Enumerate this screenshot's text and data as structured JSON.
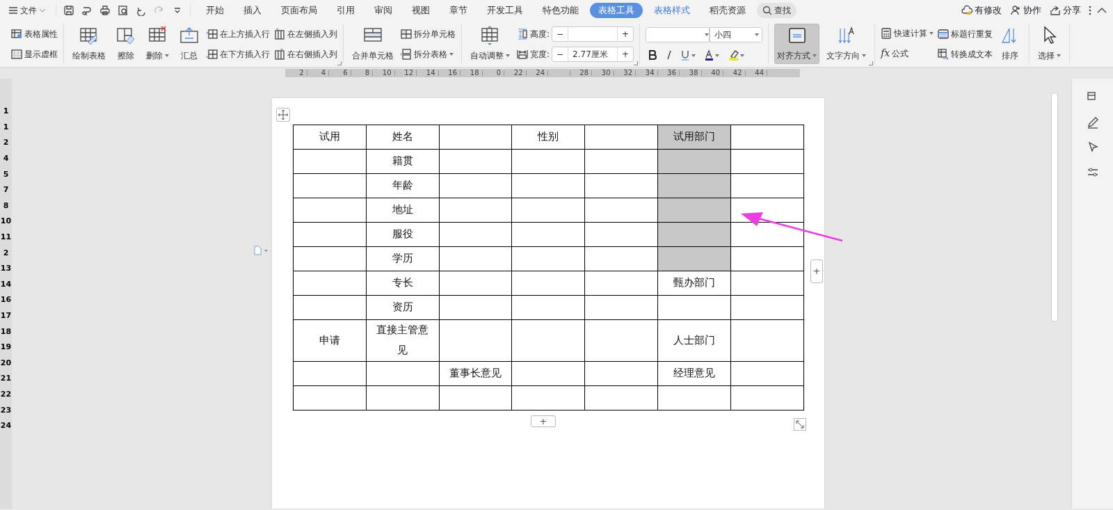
{
  "title_bar": {
    "file_menu": "文件",
    "tabs": [
      {
        "label": "开始",
        "selected": false,
        "contextual": false
      },
      {
        "label": "插入",
        "selected": false,
        "contextual": false
      },
      {
        "label": "页面布局",
        "selected": false,
        "contextual": false
      },
      {
        "label": "引用",
        "selected": false,
        "contextual": false
      },
      {
        "label": "审阅",
        "selected": false,
        "contextual": false
      },
      {
        "label": "视图",
        "selected": false,
        "contextual": false
      },
      {
        "label": "章节",
        "selected": false,
        "contextual": false
      },
      {
        "label": "开发工具",
        "selected": false,
        "contextual": false
      },
      {
        "label": "特色功能",
        "selected": false,
        "contextual": false
      },
      {
        "label": "表格工具",
        "selected": true,
        "contextual": true
      },
      {
        "label": "表格样式",
        "selected": false,
        "contextual": true
      },
      {
        "label": "稻壳资源",
        "selected": false,
        "contextual": false
      }
    ],
    "search": "查找",
    "actions": [
      "有修改",
      "协作",
      "分享"
    ]
  },
  "ribbon": [
    {
      "launcher": false,
      "columns": [
        {
          "kind": "stack",
          "items": [
            {
              "label": "表格属性",
              "dropdown": false
            },
            {
              "label": "显示虚框",
              "dropdown": false
            }
          ]
        }
      ]
    },
    {
      "launcher": true,
      "columns": [
        {
          "kind": "large",
          "label": "绘制表格",
          "dropdown": false,
          "selected": false
        },
        {
          "kind": "large",
          "label": "擦除",
          "dropdown": false,
          "selected": false
        },
        {
          "kind": "large",
          "label": "删除",
          "dropdown": true,
          "selected": false
        },
        {
          "kind": "large",
          "label": "汇总",
          "dropdown": false,
          "selected": false
        },
        {
          "kind": "stack",
          "items": [
            {
              "label": "在上方插入行",
              "dropdown": false
            },
            {
              "label": "在下方插入行",
              "dropdown": false
            }
          ]
        },
        {
          "kind": "stack",
          "items": [
            {
              "label": "在左侧插入列",
              "dropdown": false
            },
            {
              "label": "在右侧插入列",
              "dropdown": false
            }
          ]
        }
      ]
    },
    {
      "launcher": false,
      "columns": [
        {
          "kind": "large",
          "label": "合并单元格",
          "dropdown": false,
          "selected": false
        },
        {
          "kind": "stack",
          "items": [
            {
              "label": "拆分单元格",
              "dropdown": false
            },
            {
              "label": "拆分表格",
              "dropdown": true
            }
          ]
        }
      ]
    },
    {
      "launcher": true,
      "columns": [
        {
          "kind": "large",
          "label": "自动调整",
          "dropdown": true,
          "selected": false
        },
        {
          "kind": "spinners",
          "items": [
            {
              "label": "高度:",
              "decrement": "−",
              "increment": "+"
            },
            {
              "label": "宽度:",
              "value": "2.77厘米",
              "decrement": "−",
              "increment": "+"
            }
          ]
        }
      ]
    },
    {
      "launcher": false,
      "columns": [
        {
          "kind": "font",
          "size": "小四"
        }
      ]
    },
    {
      "launcher": true,
      "columns": [
        {
          "kind": "large",
          "label": "对齐方式",
          "dropdown": true,
          "selected": true
        },
        {
          "kind": "large",
          "label": "文字方向",
          "dropdown": true,
          "selected": false
        }
      ]
    },
    {
      "launcher": false,
      "columns": [
        {
          "kind": "stack",
          "items": [
            {
              "label": "快速计算",
              "dropdown": true
            },
            {
              "label": "公式",
              "dropdown": false,
              "glyph": "fx"
            }
          ]
        },
        {
          "kind": "stack",
          "items": [
            {
              "label": "标题行重复",
              "dropdown": false
            },
            {
              "label": "转换成文本",
              "dropdown": false
            }
          ]
        },
        {
          "kind": "large",
          "label": "排序",
          "dropdown": false,
          "selected": false
        }
      ]
    },
    {
      "launcher": false,
      "columns": [
        {
          "kind": "large",
          "label": "选择",
          "dropdown": true,
          "selected": false
        }
      ]
    }
  ],
  "ruler": [
    "2",
    "4",
    "6",
    "8",
    "10",
    "12",
    "14",
    "16",
    "18",
    "0",
    "22",
    "24",
    "28",
    "30",
    "32",
    "34",
    "36",
    "38",
    "40",
    "42",
    "44"
  ],
  "vertical_ruler": [
    "1",
    "1",
    "2",
    "4",
    "5",
    "7",
    "8",
    "10",
    "11",
    "2",
    "13",
    "14",
    "16",
    "17",
    "18",
    "19",
    "20",
    "21",
    "22",
    "23",
    "24"
  ],
  "table": {
    "rows": [
      [
        {
          "text": "试用",
          "selected": false
        },
        {
          "text": "姓名",
          "selected": false
        },
        {
          "selected": false
        },
        {
          "text": "性别",
          "selected": false
        },
        {
          "selected": false
        },
        {
          "text": "试用部门",
          "selected": true
        },
        {
          "selected": false
        }
      ],
      [
        {
          "selected": false
        },
        {
          "text": "籍贯",
          "selected": false
        },
        {
          "selected": false
        },
        {
          "selected": false
        },
        {
          "selected": false
        },
        {
          "selected": true
        },
        {
          "selected": false
        }
      ],
      [
        {
          "selected": false
        },
        {
          "text": "年龄",
          "selected": false
        },
        {
          "selected": false
        },
        {
          "selected": false
        },
        {
          "selected": false
        },
        {
          "selected": true
        },
        {
          "selected": false
        }
      ],
      [
        {
          "selected": false
        },
        {
          "text": "地址",
          "selected": false
        },
        {
          "selected": false
        },
        {
          "selected": false
        },
        {
          "selected": false
        },
        {
          "selected": true
        },
        {
          "selected": false
        }
      ],
      [
        {
          "selected": false
        },
        {
          "text": "服役",
          "selected": false
        },
        {
          "selected": false
        },
        {
          "selected": false
        },
        {
          "selected": false
        },
        {
          "selected": true
        },
        {
          "selected": false
        }
      ],
      [
        {
          "selected": false
        },
        {
          "text": "学历",
          "selected": false
        },
        {
          "selected": false
        },
        {
          "selected": false
        },
        {
          "selected": false
        },
        {
          "selected": true
        },
        {
          "selected": false
        }
      ],
      [
        {
          "selected": false
        },
        {
          "text": "专长",
          "selected": false
        },
        {
          "selected": false
        },
        {
          "selected": false
        },
        {
          "selected": false
        },
        {
          "text": "甄办部门",
          "selected": false
        },
        {
          "selected": false
        }
      ],
      [
        {
          "selected": false
        },
        {
          "text": "资历",
          "selected": false
        },
        {
          "selected": false
        },
        {
          "selected": false
        },
        {
          "selected": false
        },
        {
          "selected": false
        },
        {
          "selected": false
        }
      ],
      [
        {
          "text": "申请",
          "selected": false
        },
        {
          "text": "直接主管意见",
          "selected": false
        },
        {
          "selected": false
        },
        {
          "selected": false
        },
        {
          "selected": false
        },
        {
          "text": "人士部门",
          "selected": false
        },
        {
          "selected": false
        }
      ],
      [
        {
          "selected": false
        },
        {
          "selected": false
        },
        {
          "text": "董事长意见",
          "selected": false
        },
        {
          "selected": false
        },
        {
          "selected": false
        },
        {
          "text": "经理意见",
          "selected": false
        },
        {
          "selected": false
        }
      ],
      [
        {
          "selected": false
        },
        {
          "selected": false
        },
        {
          "selected": false
        },
        {
          "selected": false
        },
        {
          "selected": false
        },
        {
          "selected": false
        },
        {
          "selected": false
        }
      ]
    ]
  },
  "add_row": "+",
  "add_column": "+"
}
